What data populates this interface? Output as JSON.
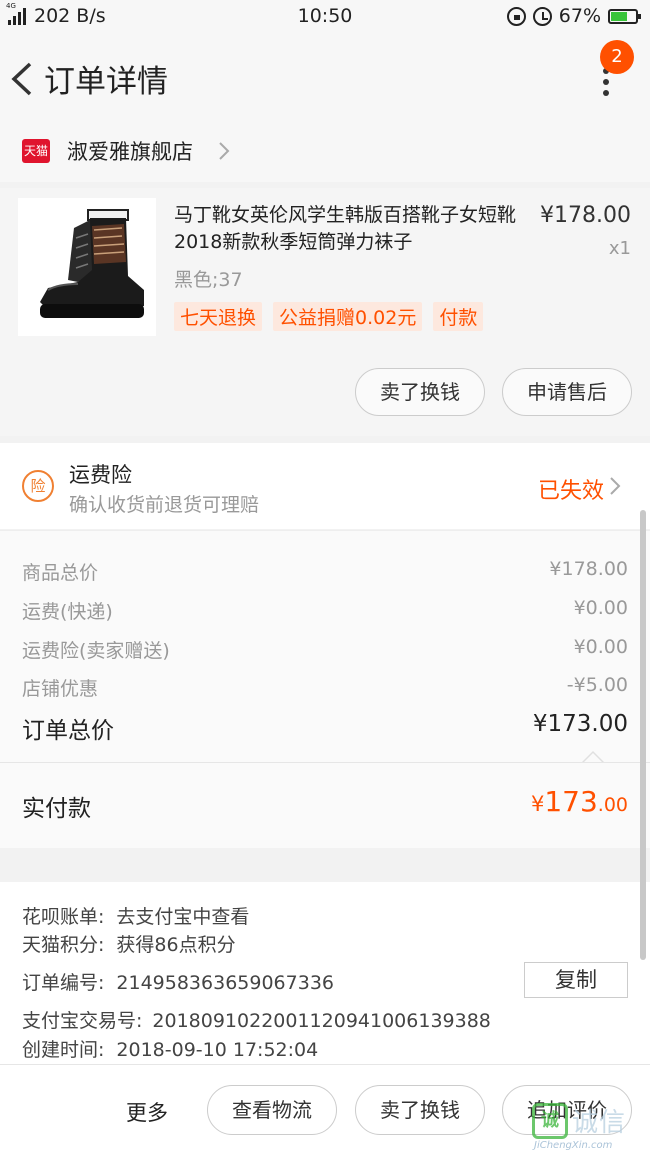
{
  "status_bar": {
    "net_type": "4G",
    "speed": "202 B/s",
    "time": "10:50",
    "battery": "67%",
    "battery_level": 0.67,
    "icons": [
      "signal-icon",
      "lock-rotation-icon",
      "alarm-icon",
      "battery-icon"
    ]
  },
  "header": {
    "title": "订单详情",
    "badge_count": "2",
    "icons": [
      "back-arrow-icon",
      "more-vertical-icon"
    ]
  },
  "shop": {
    "logo_text": "天猫",
    "name": "淑爱雅旗舰店",
    "icons": [
      "tmall-logo-icon",
      "chevron-right-icon"
    ]
  },
  "product": {
    "title": "马丁靴女英伦风学生韩版百搭靴子女短靴2018新款秋季短筒弹力袜子",
    "price": "¥178.00",
    "quantity": "x1",
    "sku": "黑色;37",
    "tags": [
      "七天退换",
      "公益捐赠0.02元",
      "付款"
    ],
    "actions": [
      "卖了换钱",
      "申请售后"
    ],
    "image": "black-martin-boot-image"
  },
  "insurance": {
    "icon_text": "险",
    "title": "运费险",
    "subtitle": "确认收货前退货可理赔",
    "status": "已失效"
  },
  "costs": [
    {
      "label": "商品总价",
      "value": "¥178.00"
    },
    {
      "label": "运费(快递)",
      "value": "¥0.00"
    },
    {
      "label": "运费险(卖家赠送)",
      "value": "¥0.00"
    },
    {
      "label": "店铺优惠",
      "value": "-¥5.00"
    }
  ],
  "order_total": {
    "label": "订单总价",
    "value": "¥173.00"
  },
  "paid": {
    "label": "实付款",
    "currency": "¥",
    "integer": "173",
    "decimal": ".00"
  },
  "details": {
    "huabei_label": "花呗账单:",
    "huabei_value": "去支付宝中查看",
    "points_label": "天猫积分:",
    "points_value": "获得86点积分",
    "order_no_label": "订单编号:",
    "order_no_value": "2149583636590673​36",
    "copy_label": "复制",
    "alipay_label": "支付宝交易号:",
    "alipay_value": "2018091022001120941006139388",
    "created_label": "创建时间:",
    "created_value": "2018-09-10 17:52:04"
  },
  "bottom_bar": {
    "more": "更多",
    "buttons": [
      "查看物流",
      "卖了换钱",
      "追加评价"
    ]
  },
  "watermark": {
    "icon_char": "诚",
    "chars": "诚信",
    "url": "JiChengXin.com"
  },
  "colors": {
    "accent": "#ff5000",
    "tmall_red": "#e0152e",
    "insurance_orange": "#f08032"
  }
}
